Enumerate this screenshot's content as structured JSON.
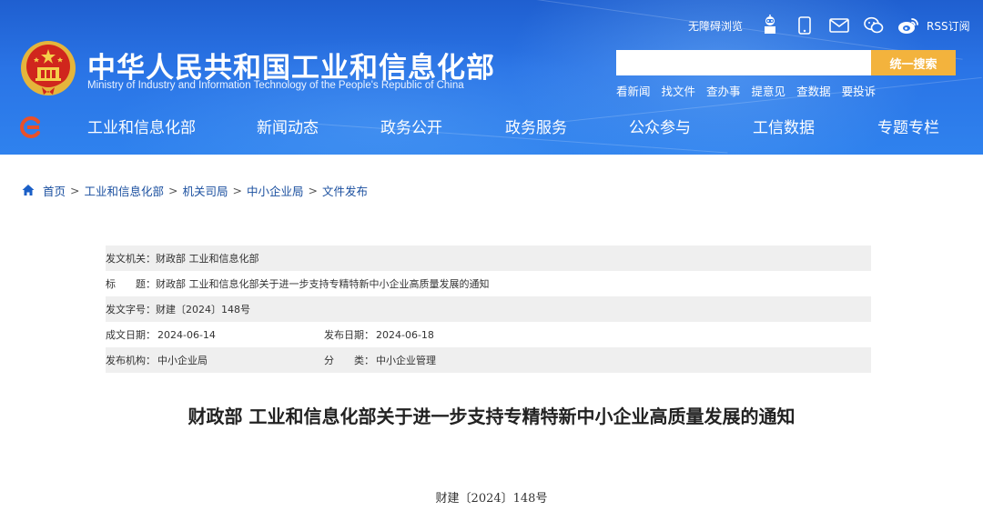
{
  "header": {
    "title": "中华人民共和国工业和信息化部",
    "subtitle": "Ministry of Industry and Information Technology of the People's Republic of China",
    "utilities": {
      "accessibility": "无障碍浏览",
      "rss": "RSS订阅"
    },
    "search": {
      "placeholder": "",
      "button_label": "统一搜索"
    },
    "quick_links": [
      "看新闻",
      "找文件",
      "查办事",
      "提意见",
      "查数据",
      "要投诉"
    ],
    "nav": [
      "工业和信息化部",
      "新闻动态",
      "政务公开",
      "政务服务",
      "公众参与",
      "工信数据",
      "专题专栏"
    ],
    "colors": {
      "bar": "#2a74e6",
      "search_button": "#f3b33d"
    }
  },
  "breadcrumb": [
    "首页",
    "工业和信息化部",
    "机关司局",
    "中小企业局",
    "文件发布"
  ],
  "meta": {
    "issuer_label": "发文机关：",
    "issuer": "财政部 工业和信息化部",
    "title_label": "标　　题：",
    "title": "财政部 工业和信息化部关于进一步支持专精特新中小企业高质量发展的通知",
    "doc_no_label": "发文字号：",
    "doc_no": "财建〔2024〕148号",
    "date_label": "成文日期：",
    "date": "2024-06-14",
    "publish_label": "发布日期：",
    "publish": "2024-06-18",
    "org_label": "发布机构：",
    "org": "中小企业局",
    "category_label": "分　　类：",
    "category": "中小企业管理"
  },
  "document": {
    "title": "财政部 工业和信息化部关于进一步支持专精特新中小企业高质量发展的通知",
    "number": "财建〔2024〕148号"
  }
}
